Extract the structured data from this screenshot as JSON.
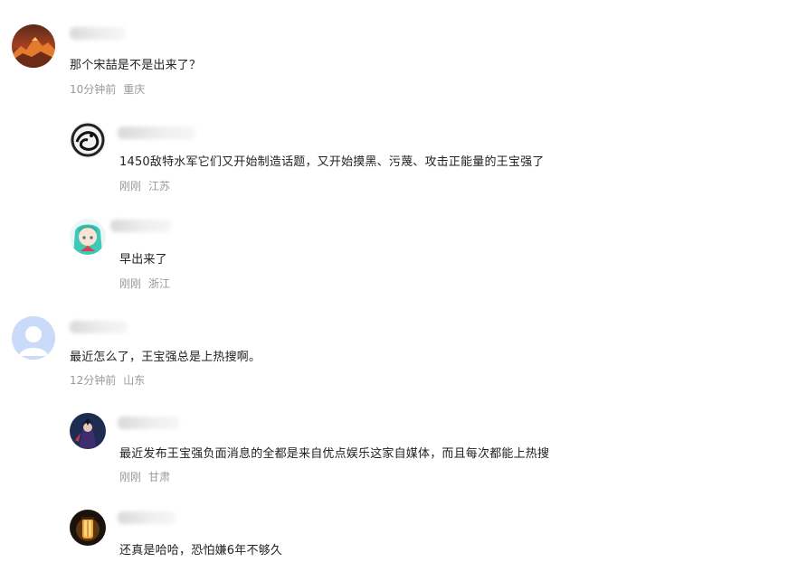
{
  "comments": [
    {
      "text": "那个宋喆是不是出来了？",
      "time": "10分钟前",
      "location": "重庆",
      "avatar_icon": "mountain-sunset-avatar",
      "replies": [
        {
          "text": "1450敌特水军它们又开始制造话题，又开始摸黑、污蔑、攻击正能量的王宝强了",
          "time": "刚刚",
          "location": "江苏",
          "avatar_icon": "ink-dragon-avatar"
        },
        {
          "text": "早出来了",
          "time": "刚刚",
          "location": "浙江",
          "avatar_icon": "anime-girl-avatar"
        }
      ]
    },
    {
      "text": "最近怎么了，王宝强总是上热搜啊。",
      "time": "12分钟前",
      "location": "山东",
      "avatar_icon": "default-user-avatar",
      "replies": [
        {
          "text": "最近发布王宝强负面消息的全都是来自优点娱乐这家自媒体，而且每次都能上热搜",
          "time": "刚刚",
          "location": "甘肃",
          "avatar_icon": "dark-fantasy-avatar"
        },
        {
          "text": "还真是哈哈，恐怕嫌6年不够久",
          "time": "",
          "location": "",
          "avatar_icon": "lantern-avatar"
        }
      ]
    }
  ],
  "colors": {
    "text": "#222222",
    "meta": "#999999",
    "default_avatar_bg": "#c5d8f7"
  }
}
